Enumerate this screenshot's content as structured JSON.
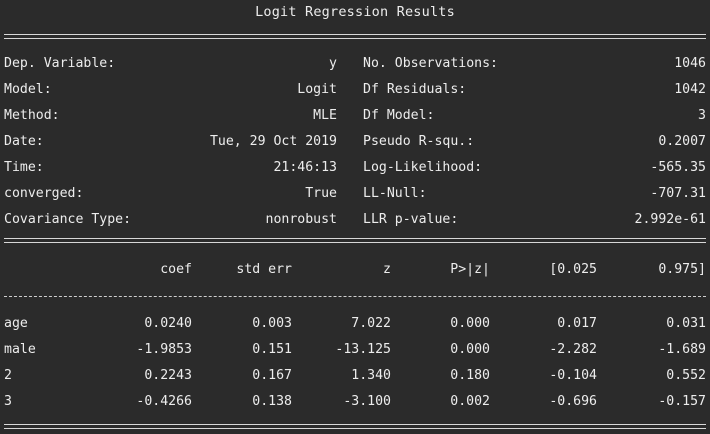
{
  "title": "Logit Regression Results",
  "summary": {
    "left": [
      {
        "label": "Dep. Variable:",
        "value": "y"
      },
      {
        "label": "Model:",
        "value": "Logit"
      },
      {
        "label": "Method:",
        "value": "MLE"
      },
      {
        "label": "Date:",
        "value": "Tue, 29 Oct 2019"
      },
      {
        "label": "Time:",
        "value": "21:46:13"
      },
      {
        "label": "converged:",
        "value": "True"
      },
      {
        "label": "Covariance Type:",
        "value": "nonrobust"
      }
    ],
    "right": [
      {
        "label": "No. Observations:",
        "value": "1046"
      },
      {
        "label": "Df Residuals:",
        "value": "1042"
      },
      {
        "label": "Df Model:",
        "value": "3"
      },
      {
        "label": "Pseudo R-squ.:",
        "value": "0.2007"
      },
      {
        "label": "Log-Likelihood:",
        "value": "-565.35"
      },
      {
        "label": "LL-Null:",
        "value": "-707.31"
      },
      {
        "label": "LLR p-value:",
        "value": "2.992e-61"
      }
    ]
  },
  "coef_table": {
    "headers": [
      "coef",
      "std err",
      "z",
      "P>|z|",
      "[0.025",
      "0.975]"
    ],
    "rows": [
      {
        "name": "age",
        "values": [
          "0.0240",
          "0.003",
          "7.022",
          "0.000",
          "0.017",
          "0.031"
        ]
      },
      {
        "name": "male",
        "values": [
          "-1.9853",
          "0.151",
          "-13.125",
          "0.000",
          "-2.282",
          "-1.689"
        ]
      },
      {
        "name": "2",
        "values": [
          "0.2243",
          "0.167",
          "1.340",
          "0.180",
          "-0.104",
          "0.552"
        ]
      },
      {
        "name": "3",
        "values": [
          "-0.4266",
          "0.138",
          "-3.100",
          "0.002",
          "-0.696",
          "-0.157"
        ]
      }
    ]
  }
}
